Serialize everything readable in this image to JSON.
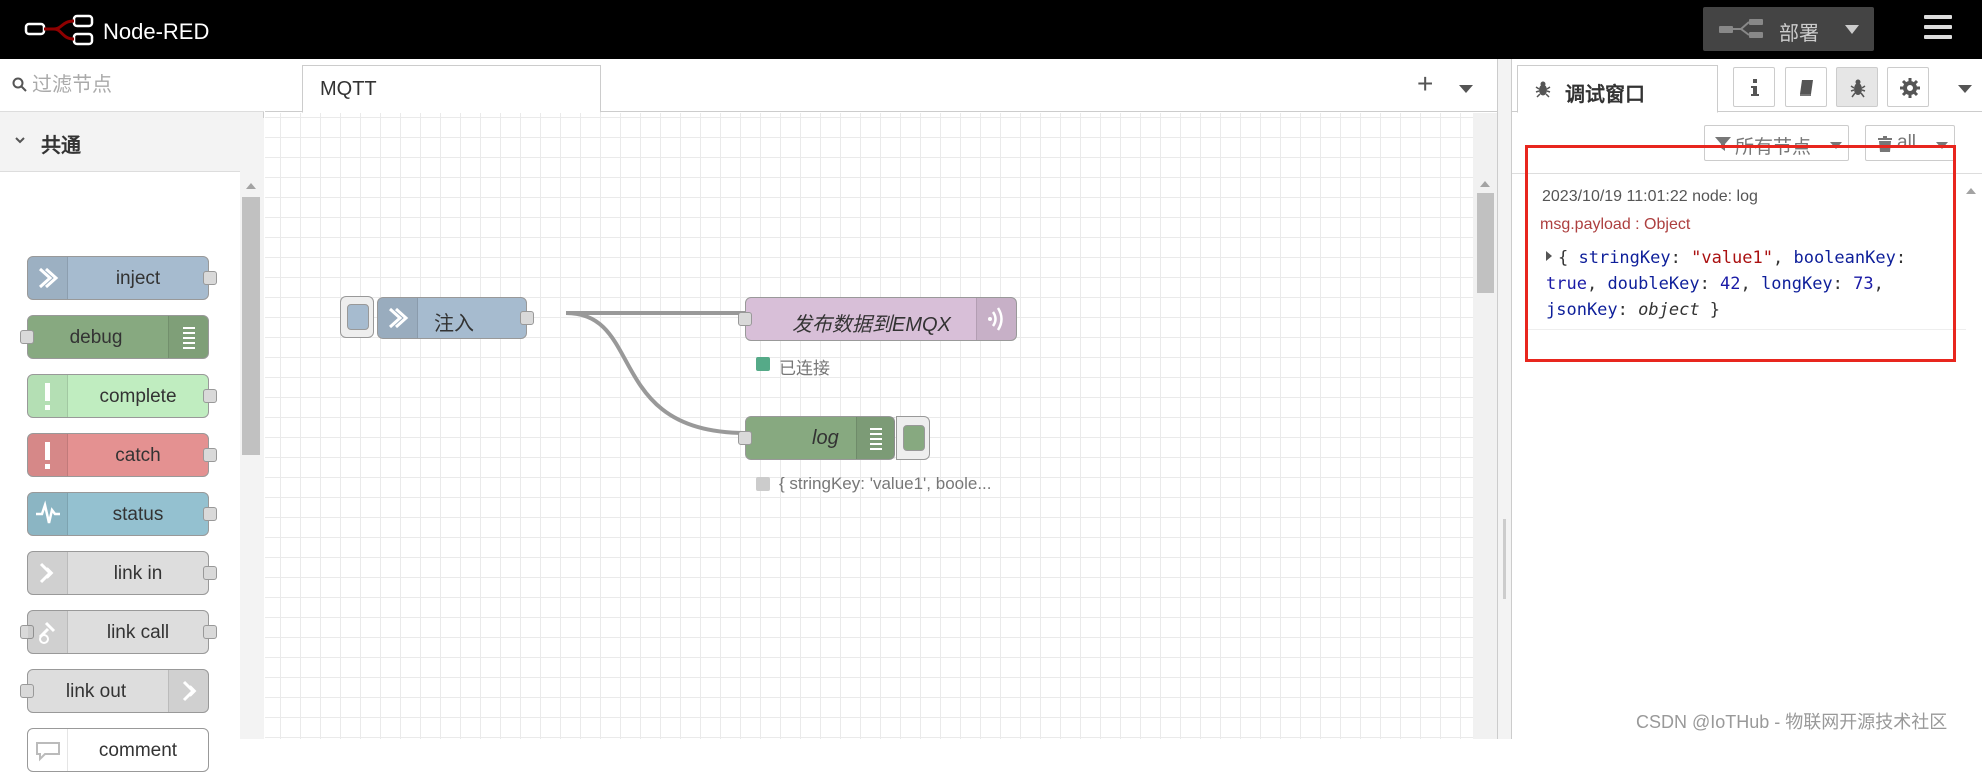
{
  "header": {
    "app_title": "Node-RED",
    "deploy_label": "部署",
    "colors": {
      "bar": "#000000",
      "deploy_bg": "#444444",
      "logo_red": "#8f0000"
    }
  },
  "palette": {
    "search_placeholder": "过滤节点",
    "category_label": "共通",
    "nodes": [
      {
        "label": "inject",
        "color": "#a6bbcf",
        "icon": "arrow-in-icon"
      },
      {
        "label": "debug",
        "color": "#87a980",
        "icon": "list-icon"
      },
      {
        "label": "complete",
        "color": "#c0edc0",
        "icon": "exclamation-icon"
      },
      {
        "label": "catch",
        "color": "#e49191",
        "icon": "exclamation-icon"
      },
      {
        "label": "status",
        "color": "#94c1d0",
        "icon": "pulse-icon"
      },
      {
        "label": "link in",
        "color": "#dddddd",
        "icon": "link-in-icon"
      },
      {
        "label": "link call",
        "color": "#dddddd",
        "icon": "link-call-icon"
      },
      {
        "label": "link out",
        "color": "#dddddd",
        "icon": "link-out-icon"
      },
      {
        "label": "comment",
        "color": "#ffffff",
        "icon": "speech-bubble-icon"
      }
    ]
  },
  "workspace": {
    "tab_label": "MQTT",
    "flow_nodes": {
      "inject": {
        "label": "注入",
        "color": "#a6bbcf"
      },
      "mqtt_out": {
        "label": "发布数据到EMQX",
        "color": "#d8bfd8",
        "status": "已连接",
        "status_color": "#5a8"
      },
      "debug": {
        "label": "log",
        "color": "#87a980",
        "status": "{ stringKey: 'value1', boole...",
        "status_color": "#cccccc"
      }
    }
  },
  "sidebar": {
    "tab_label": "调试窗口",
    "filter_label": "所有节点",
    "clear_label": "all",
    "message": {
      "meta": "2023/10/19 11:01:22   node: log",
      "path": "msg.payload : Object",
      "payload": {
        "k1": "stringKey",
        "v1": "\"value1\"",
        "k2": "booleanKey",
        "v2": "true",
        "k3": "doubleKey",
        "v3": "42",
        "k4": "longKey",
        "v4": "73",
        "k5": "jsonKey",
        "v5": "object"
      }
    },
    "highlight_color": "#e8261e"
  },
  "watermark": "CSDN @IoTHub - 物联网开源技术社区"
}
